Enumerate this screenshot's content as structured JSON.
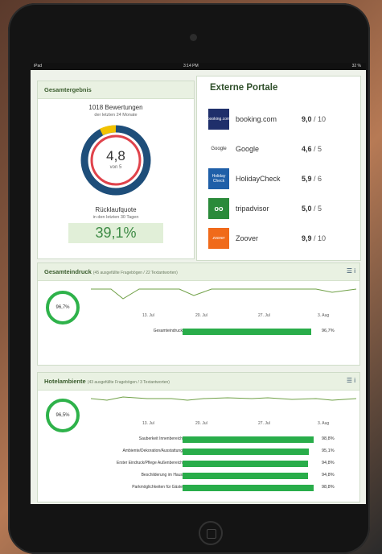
{
  "status": {
    "device": "iPad",
    "time": "3:14 PM",
    "battery": "32 %"
  },
  "overall": {
    "title": "Gesamtergebnis",
    "reviews": "1018 Bewertungen",
    "period": "der letzten 24 Monate",
    "score": "4,8",
    "score_of": "von 5",
    "return_label": "Rücklaufquote",
    "return_period": "in den letzten 30 Tagen",
    "return_value": "39,1%"
  },
  "external": {
    "title": "Externe Portale",
    "portals": [
      {
        "name": "booking.com",
        "score": "9,0",
        "max": "/ 10",
        "logo": "booking.com",
        "color": "#1f2f6b"
      },
      {
        "name": "Google",
        "score": "4,6",
        "max": "/ 5",
        "logo": "Google",
        "color": "#ffffff"
      },
      {
        "name": "HolidayCheck",
        "score": "5,9",
        "max": "/ 6",
        "logo": "Holiday Check",
        "color": "#1f5fa8"
      },
      {
        "name": "tripadvisor",
        "score": "5,0",
        "max": "/ 5",
        "logo": "oo",
        "color": "#2a8a3a"
      },
      {
        "name": "Zoover",
        "score": "9,9",
        "max": "/ 10",
        "logo": "zoover",
        "color": "#f06a1a"
      }
    ]
  },
  "impression": {
    "title": "Gesamteindruck",
    "subtitle": "(45 ausgefüllte Fragebögen / 22 Textantworten)",
    "circle": "96,7%",
    "axis": [
      "13. Jul",
      "20. Jul",
      "27. Jul",
      "3. Aug"
    ],
    "rows": [
      {
        "label": "Gesamteindruck",
        "value": 96.7,
        "text": "96,7%"
      }
    ]
  },
  "ambience": {
    "title": "Hotelambiente",
    "subtitle": "(43 ausgefüllte Fragebögen / 3 Textantworten)",
    "circle": "96,5%",
    "axis": [
      "13. Jul",
      "20. Jul",
      "27. Jul",
      "3. Aug"
    ],
    "rows": [
      {
        "label": "Sauberkeit Innenbereich",
        "value": 98.8,
        "text": "98,8%"
      },
      {
        "label": "Ambiente/Dekoration/Ausstattung",
        "value": 95.1,
        "text": "95,1%"
      },
      {
        "label": "Erster Eindruck/Pflege Außenbereich",
        "value": 94.8,
        "text": "94,8%"
      },
      {
        "label": "Beschilderung im Haus",
        "value": 94.8,
        "text": "94,8%"
      },
      {
        "label": "Parkmöglichkeiten für Gäste",
        "value": 98.8,
        "text": "98,8%"
      }
    ]
  },
  "colors": {
    "accent": "#2eb24a",
    "donut_blue": "#1e4e7a",
    "donut_red": "#e0434b"
  }
}
